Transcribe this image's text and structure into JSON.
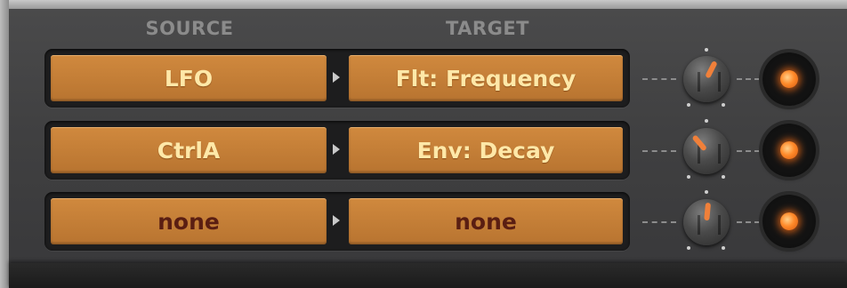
{
  "headers": {
    "source": "SOURCE",
    "target": "TARGET"
  },
  "rows": [
    {
      "source": "LFO",
      "target": "Flt: Frequency",
      "source_active": true,
      "target_active": true,
      "amount_knob": 0.6,
      "led_on": true
    },
    {
      "source": "CtrlA",
      "target": "Env: Decay",
      "source_active": true,
      "target_active": true,
      "amount_knob": 0.35,
      "led_on": true
    },
    {
      "source": "none",
      "target": "none",
      "source_active": false,
      "target_active": false,
      "amount_knob": 0.52,
      "led_on": true
    }
  ],
  "icons": {
    "arrow": "play-arrow-icon",
    "knob": "amount-knob",
    "led": "enable-led"
  },
  "colors": {
    "slot_orange": "#c27c35",
    "text_active": "#ffe8a8",
    "text_none": "#5a1e12",
    "led": "#ff8a2a",
    "knob_indicator": "#f0803a",
    "header_gray": "#8b8b8b"
  }
}
